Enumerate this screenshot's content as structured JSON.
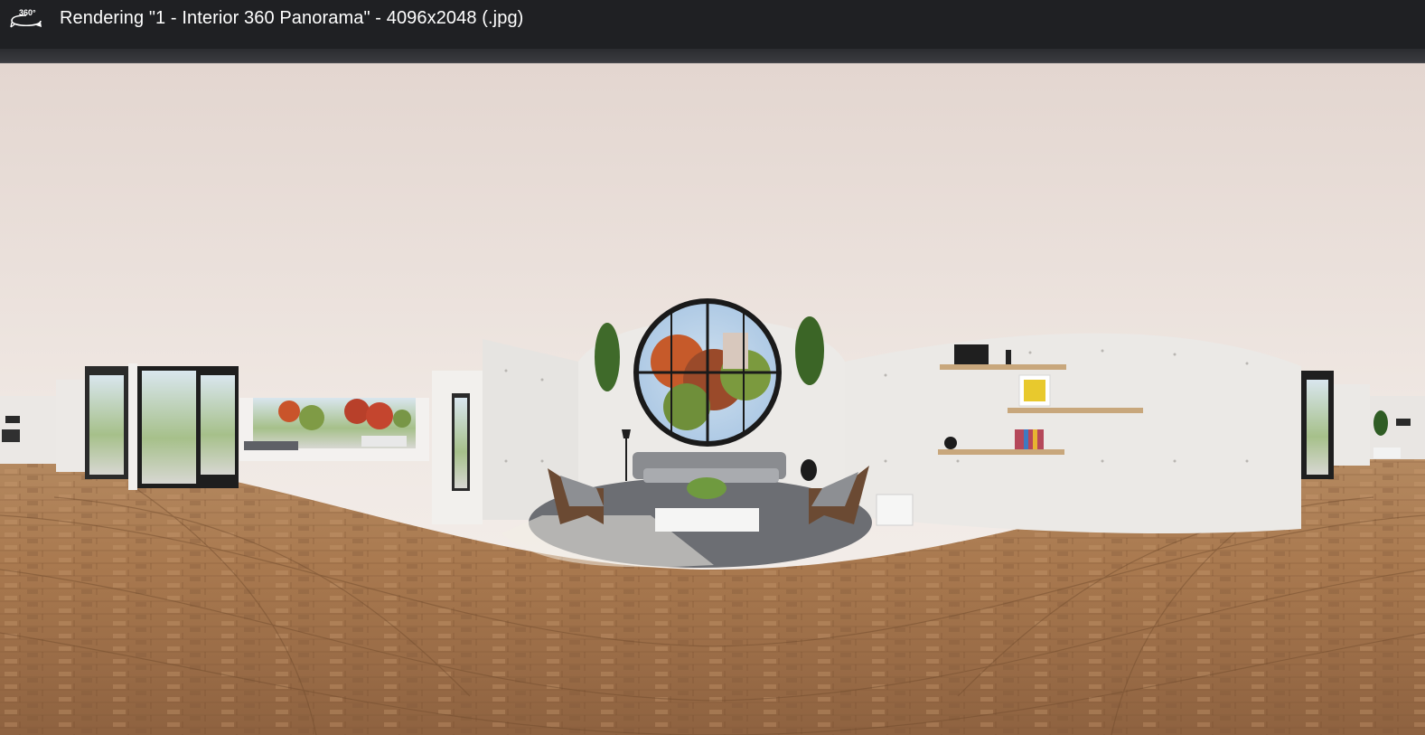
{
  "window": {
    "title": "Rendering \"1 - Interior 360 Panorama\" - 4096x2048 (.jpg)",
    "icon": "360-panorama-icon",
    "icon_badge": "360°"
  },
  "colors": {
    "titlebar": "#1f2023",
    "ceiling": "#ece3de",
    "wall": "#e8e6e3",
    "floor": "#a87a52",
    "rug": "#6d6f74"
  }
}
